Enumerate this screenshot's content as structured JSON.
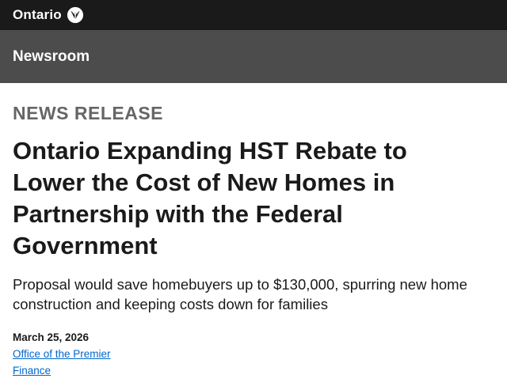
{
  "header": {
    "brand_label": "Ontario",
    "logo_icon": "trillium-icon"
  },
  "newsroom": {
    "label": "Newsroom"
  },
  "article": {
    "kicker": "NEWS RELEASE",
    "title": "Ontario Expanding HST Rebate to Lower the Cost of New Homes in Partnership with the Federal Government",
    "subtitle": "Proposal would save homebuyers up to $130,000, spurring new home construction and keeping costs down for families",
    "date": "March 25, 2026",
    "links": [
      "Office of the Premier",
      "Finance"
    ]
  },
  "colors": {
    "topbar": "#1a1a1a",
    "newsbar": "#4c4c4c",
    "link": "#0066cc",
    "kicker": "#666666"
  }
}
